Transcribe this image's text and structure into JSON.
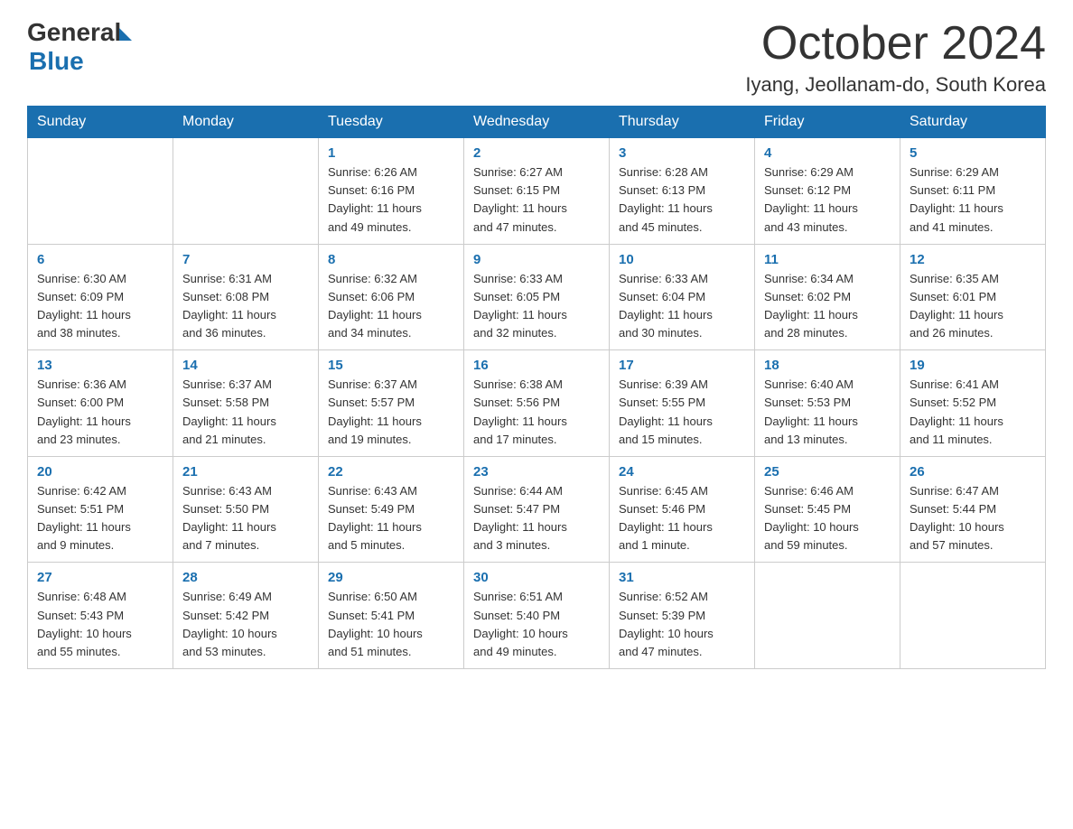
{
  "header": {
    "logo_general": "General",
    "logo_blue": "Blue",
    "month_title": "October 2024",
    "location": "Iyang, Jeollanam-do, South Korea"
  },
  "days_of_week": [
    "Sunday",
    "Monday",
    "Tuesday",
    "Wednesday",
    "Thursday",
    "Friday",
    "Saturday"
  ],
  "weeks": [
    [
      {
        "day": "",
        "info": ""
      },
      {
        "day": "",
        "info": ""
      },
      {
        "day": "1",
        "info": "Sunrise: 6:26 AM\nSunset: 6:16 PM\nDaylight: 11 hours\nand 49 minutes."
      },
      {
        "day": "2",
        "info": "Sunrise: 6:27 AM\nSunset: 6:15 PM\nDaylight: 11 hours\nand 47 minutes."
      },
      {
        "day": "3",
        "info": "Sunrise: 6:28 AM\nSunset: 6:13 PM\nDaylight: 11 hours\nand 45 minutes."
      },
      {
        "day": "4",
        "info": "Sunrise: 6:29 AM\nSunset: 6:12 PM\nDaylight: 11 hours\nand 43 minutes."
      },
      {
        "day": "5",
        "info": "Sunrise: 6:29 AM\nSunset: 6:11 PM\nDaylight: 11 hours\nand 41 minutes."
      }
    ],
    [
      {
        "day": "6",
        "info": "Sunrise: 6:30 AM\nSunset: 6:09 PM\nDaylight: 11 hours\nand 38 minutes."
      },
      {
        "day": "7",
        "info": "Sunrise: 6:31 AM\nSunset: 6:08 PM\nDaylight: 11 hours\nand 36 minutes."
      },
      {
        "day": "8",
        "info": "Sunrise: 6:32 AM\nSunset: 6:06 PM\nDaylight: 11 hours\nand 34 minutes."
      },
      {
        "day": "9",
        "info": "Sunrise: 6:33 AM\nSunset: 6:05 PM\nDaylight: 11 hours\nand 32 minutes."
      },
      {
        "day": "10",
        "info": "Sunrise: 6:33 AM\nSunset: 6:04 PM\nDaylight: 11 hours\nand 30 minutes."
      },
      {
        "day": "11",
        "info": "Sunrise: 6:34 AM\nSunset: 6:02 PM\nDaylight: 11 hours\nand 28 minutes."
      },
      {
        "day": "12",
        "info": "Sunrise: 6:35 AM\nSunset: 6:01 PM\nDaylight: 11 hours\nand 26 minutes."
      }
    ],
    [
      {
        "day": "13",
        "info": "Sunrise: 6:36 AM\nSunset: 6:00 PM\nDaylight: 11 hours\nand 23 minutes."
      },
      {
        "day": "14",
        "info": "Sunrise: 6:37 AM\nSunset: 5:58 PM\nDaylight: 11 hours\nand 21 minutes."
      },
      {
        "day": "15",
        "info": "Sunrise: 6:37 AM\nSunset: 5:57 PM\nDaylight: 11 hours\nand 19 minutes."
      },
      {
        "day": "16",
        "info": "Sunrise: 6:38 AM\nSunset: 5:56 PM\nDaylight: 11 hours\nand 17 minutes."
      },
      {
        "day": "17",
        "info": "Sunrise: 6:39 AM\nSunset: 5:55 PM\nDaylight: 11 hours\nand 15 minutes."
      },
      {
        "day": "18",
        "info": "Sunrise: 6:40 AM\nSunset: 5:53 PM\nDaylight: 11 hours\nand 13 minutes."
      },
      {
        "day": "19",
        "info": "Sunrise: 6:41 AM\nSunset: 5:52 PM\nDaylight: 11 hours\nand 11 minutes."
      }
    ],
    [
      {
        "day": "20",
        "info": "Sunrise: 6:42 AM\nSunset: 5:51 PM\nDaylight: 11 hours\nand 9 minutes."
      },
      {
        "day": "21",
        "info": "Sunrise: 6:43 AM\nSunset: 5:50 PM\nDaylight: 11 hours\nand 7 minutes."
      },
      {
        "day": "22",
        "info": "Sunrise: 6:43 AM\nSunset: 5:49 PM\nDaylight: 11 hours\nand 5 minutes."
      },
      {
        "day": "23",
        "info": "Sunrise: 6:44 AM\nSunset: 5:47 PM\nDaylight: 11 hours\nand 3 minutes."
      },
      {
        "day": "24",
        "info": "Sunrise: 6:45 AM\nSunset: 5:46 PM\nDaylight: 11 hours\nand 1 minute."
      },
      {
        "day": "25",
        "info": "Sunrise: 6:46 AM\nSunset: 5:45 PM\nDaylight: 10 hours\nand 59 minutes."
      },
      {
        "day": "26",
        "info": "Sunrise: 6:47 AM\nSunset: 5:44 PM\nDaylight: 10 hours\nand 57 minutes."
      }
    ],
    [
      {
        "day": "27",
        "info": "Sunrise: 6:48 AM\nSunset: 5:43 PM\nDaylight: 10 hours\nand 55 minutes."
      },
      {
        "day": "28",
        "info": "Sunrise: 6:49 AM\nSunset: 5:42 PM\nDaylight: 10 hours\nand 53 minutes."
      },
      {
        "day": "29",
        "info": "Sunrise: 6:50 AM\nSunset: 5:41 PM\nDaylight: 10 hours\nand 51 minutes."
      },
      {
        "day": "30",
        "info": "Sunrise: 6:51 AM\nSunset: 5:40 PM\nDaylight: 10 hours\nand 49 minutes."
      },
      {
        "day": "31",
        "info": "Sunrise: 6:52 AM\nSunset: 5:39 PM\nDaylight: 10 hours\nand 47 minutes."
      },
      {
        "day": "",
        "info": ""
      },
      {
        "day": "",
        "info": ""
      }
    ]
  ]
}
